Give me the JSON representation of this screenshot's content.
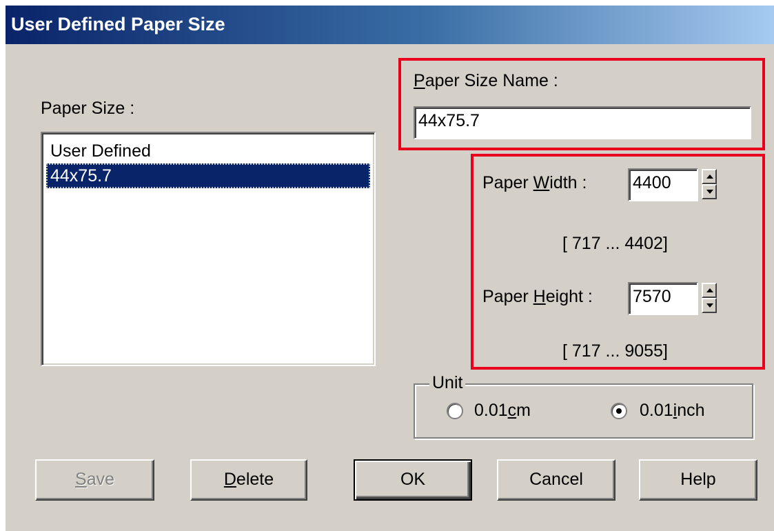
{
  "window": {
    "title": "User Defined Paper Size"
  },
  "paper_size_list": {
    "label": "Paper Size :",
    "items": [
      "User Defined",
      "44x75.7"
    ],
    "selected": "44x75.7"
  },
  "paper_size_name": {
    "label_mnemonic": "P",
    "label_rest": "aper Size Name :",
    "value": "44x75.7"
  },
  "paper_width": {
    "label_pre": "Paper ",
    "label_mnemonic": "W",
    "label_post": "idth  :",
    "value": "4400",
    "range": "[  717 ...  4402]"
  },
  "paper_height": {
    "label_pre": "Paper ",
    "label_mnemonic": "H",
    "label_post": "eight :",
    "value": "7570",
    "range": "[  717 ...  9055]"
  },
  "unit": {
    "label": "Unit",
    "options": [
      {
        "pre": "0.01",
        "mnemonic": "c",
        "post": "m",
        "selected": false
      },
      {
        "pre": "0.01",
        "mnemonic": "i",
        "post": "nch",
        "selected": true
      }
    ]
  },
  "buttons": {
    "save": {
      "mnemonic": "S",
      "rest": "ave",
      "enabled": false
    },
    "delete": {
      "mnemonic": "D",
      "rest": "elete"
    },
    "ok": "OK",
    "cancel": "Cancel",
    "help": "Help"
  },
  "colors": {
    "highlight": "#e8001c",
    "selection": "#0a246a",
    "dialog": "#d4d0c8"
  }
}
